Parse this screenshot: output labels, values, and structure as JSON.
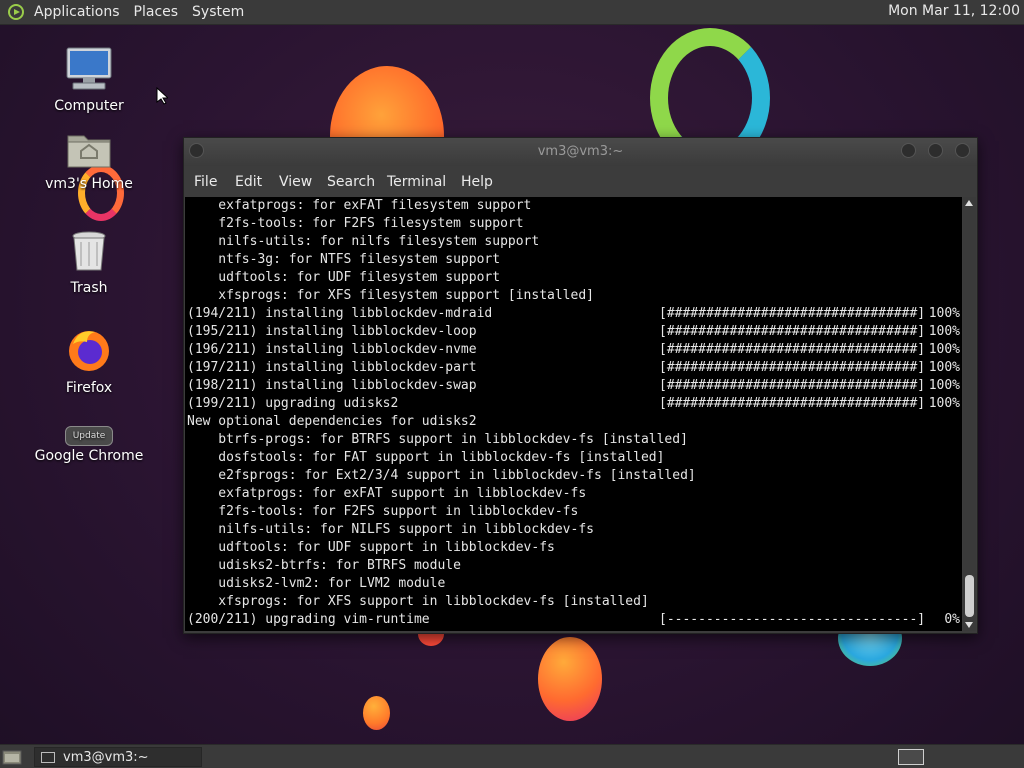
{
  "top_panel": {
    "menus": [
      "Applications",
      "Places",
      "System"
    ],
    "clock": "Mon Mar 11, 12:00"
  },
  "desktop_icons": [
    {
      "label": "Computer",
      "icon": "computer-icon"
    },
    {
      "label": "vm3's Home",
      "icon": "home-folder-icon"
    },
    {
      "label": "Trash",
      "icon": "trash-icon"
    },
    {
      "label": "Firefox",
      "icon": "firefox-icon"
    },
    {
      "label": "Google Chrome",
      "icon": "chrome-icon",
      "badge": "Update"
    }
  ],
  "terminal": {
    "title": "vm3@vm3:~",
    "menu": [
      "File",
      "Edit",
      "View",
      "Search",
      "Terminal",
      "Help"
    ],
    "lines": [
      {
        "text": "    exfatprogs: for exFAT filesystem support"
      },
      {
        "text": "    f2fs-tools: for F2FS filesystem support"
      },
      {
        "text": "    nilfs-utils: for nilfs filesystem support"
      },
      {
        "text": "    ntfs-3g: for NTFS filesystem support"
      },
      {
        "text": "    udftools: for UDF filesystem support"
      },
      {
        "text": "    xfsprogs: for XFS filesystem support [installed]"
      },
      {
        "text": "(194/211) installing libblockdev-mdraid",
        "bar": "[################################]",
        "pct": "100%"
      },
      {
        "text": "(195/211) installing libblockdev-loop",
        "bar": "[################################]",
        "pct": "100%"
      },
      {
        "text": "(196/211) installing libblockdev-nvme",
        "bar": "[################################]",
        "pct": "100%"
      },
      {
        "text": "(197/211) installing libblockdev-part",
        "bar": "[################################]",
        "pct": "100%"
      },
      {
        "text": "(198/211) installing libblockdev-swap",
        "bar": "[################################]",
        "pct": "100%"
      },
      {
        "text": "(199/211) upgrading udisks2",
        "bar": "[################################]",
        "pct": "100%"
      },
      {
        "text": "New optional dependencies for udisks2"
      },
      {
        "text": "    btrfs-progs: for BTRFS support in libblockdev-fs [installed]"
      },
      {
        "text": "    dosfstools: for FAT support in libblockdev-fs [installed]"
      },
      {
        "text": "    e2fsprogs: for Ext2/3/4 support in libblockdev-fs [installed]"
      },
      {
        "text": "    exfatprogs: for exFAT support in libblockdev-fs"
      },
      {
        "text": "    f2fs-tools: for F2FS support in libblockdev-fs"
      },
      {
        "text": "    nilfs-utils: for NILFS support in libblockdev-fs"
      },
      {
        "text": "    udftools: for UDF support in libblockdev-fs"
      },
      {
        "text": "    udisks2-btrfs: for BTRFS module"
      },
      {
        "text": "    udisks2-lvm2: for LVM2 module"
      },
      {
        "text": "    xfsprogs: for XFS support in libblockdev-fs [installed]"
      },
      {
        "text": "(200/211) upgrading vim-runtime",
        "bar": "[--------------------------------]",
        "pct": "0%"
      }
    ]
  },
  "bottom_panel": {
    "task_label": "vm3@vm3:~"
  }
}
